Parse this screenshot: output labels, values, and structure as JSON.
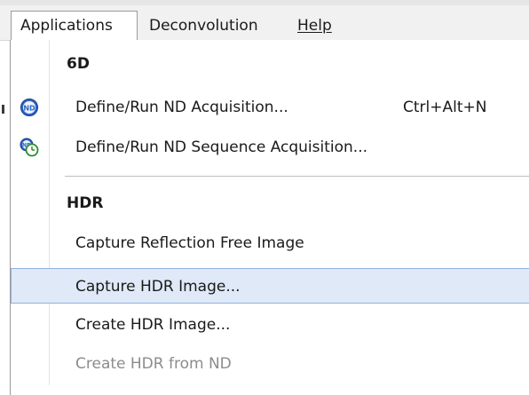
{
  "menubar": {
    "items": [
      {
        "label": "Applications",
        "active": true
      },
      {
        "label": "Deconvolution",
        "active": false
      },
      {
        "label": "Help",
        "active": false
      }
    ]
  },
  "dropdown": {
    "sections": [
      {
        "heading": "6D",
        "items": [
          {
            "label": "Define/Run ND Acquisition...",
            "shortcut": "Ctrl+Alt+N",
            "icon": "nd-icon"
          },
          {
            "label": "Define/Run ND Sequence Acquisition...",
            "icon": "nd-sequence-clock-icon"
          }
        ]
      },
      {
        "heading": "HDR",
        "items": [
          {
            "label": "Capture Reflection Free Image"
          },
          {
            "label": "Capture HDR Image...",
            "highlighted": true
          },
          {
            "label": "Create HDR Image..."
          },
          {
            "label": "Create HDR from ND",
            "disabled": true
          }
        ]
      }
    ]
  },
  "colors": {
    "highlight_bg": "#dfe9f7",
    "highlight_border": "#8fb2dd",
    "disabled_text": "#8c8c8c",
    "icon_blue": "#2b63c8"
  }
}
